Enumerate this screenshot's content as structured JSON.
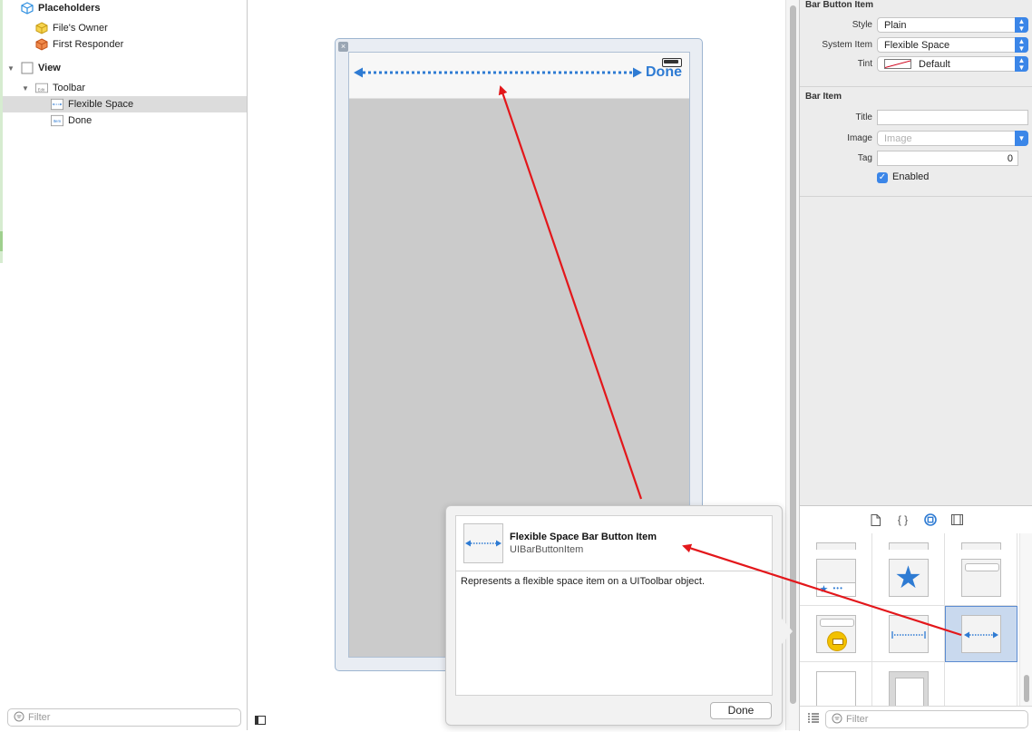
{
  "outline": {
    "placeholders_label": "Placeholders",
    "files_owner_label": "File's Owner",
    "first_responder_label": "First Responder",
    "view_label": "View",
    "toolbar_label": "Toolbar",
    "flexible_space_label": "Flexible Space",
    "done_item_label": "Done",
    "filter_placeholder": "Filter"
  },
  "canvas": {
    "toolbar_done_label": "Done"
  },
  "popover": {
    "title": "Flexible Space Bar Button Item",
    "subtitle": "UIBarButtonItem",
    "description": "Represents a flexible space item on a UIToolbar object.",
    "done_label": "Done"
  },
  "inspector": {
    "bar_button_item_title": "Bar Button Item",
    "style_label": "Style",
    "style_value": "Plain",
    "system_item_label": "System Item",
    "system_item_value": "Flexible Space",
    "tint_label": "Tint",
    "tint_value": "Default",
    "bar_item_title": "Bar Item",
    "title_label": "Title",
    "title_value": "",
    "image_label": "Image",
    "image_placeholder": "Image",
    "tag_label": "Tag",
    "tag_value": "0",
    "enabled_label": "Enabled",
    "enabled_checked": true
  },
  "library": {
    "filter_placeholder": "Filter",
    "tabs": [
      "file-template-icon",
      "code-snippet-icon",
      "object-library-icon",
      "media-library-icon"
    ],
    "active_tab": "object-library-icon",
    "selected_item": "flexible-space-bar-button-item"
  },
  "colors": {
    "accent": "#2e7bd3",
    "arrow": "#e3171b",
    "selection": "#c9d9ee"
  }
}
